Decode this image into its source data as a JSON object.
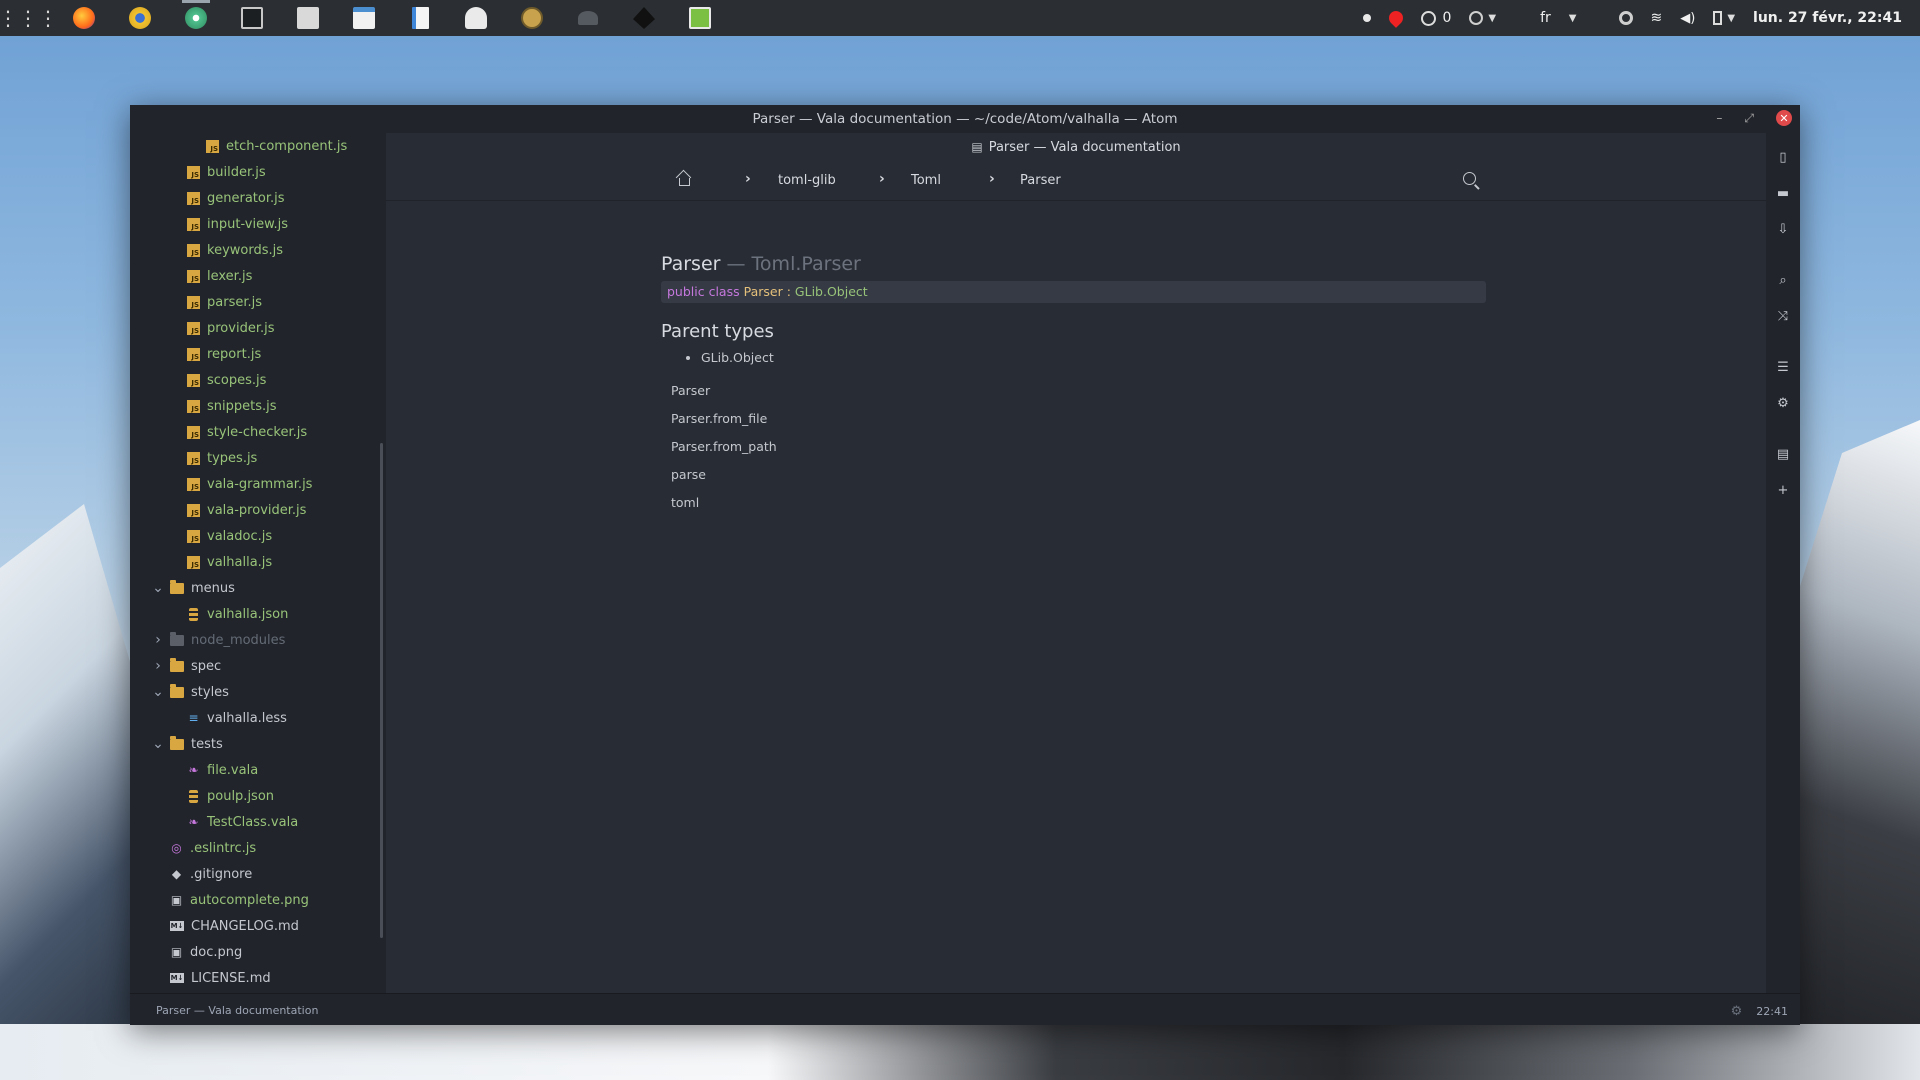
{
  "window": {
    "title": "Parser — Vala documentation — ~/code/Atom/valhalla — Atom",
    "minimize": "–",
    "maximize": "⤢",
    "close": "✕"
  },
  "topbar": {
    "apps_glyph": "⋮⋮⋮",
    "github_count": "0",
    "keyboard_layout": "fr",
    "clock": "lun. 27 févr., 22:41"
  },
  "tree": {
    "rows": [
      {
        "label": "etch-component.js",
        "type": "js",
        "color": "green"
      },
      {
        "label": "builder.js",
        "type": "js",
        "color": "green"
      },
      {
        "label": "generator.js",
        "type": "js",
        "color": "green"
      },
      {
        "label": "input-view.js",
        "type": "js",
        "color": "green"
      },
      {
        "label": "keywords.js",
        "type": "js",
        "color": "green"
      },
      {
        "label": "lexer.js",
        "type": "js",
        "color": "green"
      },
      {
        "label": "parser.js",
        "type": "js",
        "color": "green"
      },
      {
        "label": "provider.js",
        "type": "js",
        "color": "green"
      },
      {
        "label": "report.js",
        "type": "js",
        "color": "green"
      },
      {
        "label": "scopes.js",
        "type": "js",
        "color": "green"
      },
      {
        "label": "snippets.js",
        "type": "js",
        "color": "green"
      },
      {
        "label": "style-checker.js",
        "type": "js",
        "color": "green"
      },
      {
        "label": "types.js",
        "type": "js",
        "color": "green"
      },
      {
        "label": "vala-grammar.js",
        "type": "js",
        "color": "green"
      },
      {
        "label": "vala-provider.js",
        "type": "js",
        "color": "green"
      },
      {
        "label": "valadoc.js",
        "type": "js",
        "color": "green"
      },
      {
        "label": "valhalla.js",
        "type": "js",
        "color": "green"
      },
      {
        "label": "menus",
        "type": "folder-open",
        "color": "plain"
      },
      {
        "label": "valhalla.json",
        "type": "json",
        "color": "green"
      },
      {
        "label": "node_modules",
        "type": "folder-closed-dim",
        "color": "dim"
      },
      {
        "label": "spec",
        "type": "folder-closed",
        "color": "plain"
      },
      {
        "label": "styles",
        "type": "folder-open",
        "color": "plain"
      },
      {
        "label": "valhalla.less",
        "type": "less",
        "color": "plain"
      },
      {
        "label": "tests",
        "type": "folder-open",
        "color": "plain"
      },
      {
        "label": "file.vala",
        "type": "vala",
        "color": "green"
      },
      {
        "label": "poulp.json",
        "type": "json",
        "color": "green"
      },
      {
        "label": "TestClass.vala",
        "type": "vala",
        "color": "green"
      },
      {
        "label": ".eslintrc.js",
        "type": "eslint",
        "color": "green"
      },
      {
        "label": ".gitignore",
        "type": "git",
        "color": "plain"
      },
      {
        "label": "autocomplete.png",
        "type": "image",
        "color": "green"
      },
      {
        "label": "CHANGELOG.md",
        "type": "md",
        "color": "plain"
      },
      {
        "label": "doc.png",
        "type": "image",
        "color": "plain"
      },
      {
        "label": "LICENSE.md",
        "type": "md",
        "color": "plain"
      }
    ]
  },
  "doc": {
    "tab_title": "Parser — Vala documentation",
    "breadcrumbs": [
      "toml-glib",
      "Toml",
      "Parser"
    ],
    "heading": "Parser",
    "heading_sub": "— Toml.Parser",
    "signature": {
      "keyword": "public class",
      "class_name": "Parser",
      "colon": ":",
      "base": "GLib.Object"
    },
    "parent_types_title": "Parent types",
    "parent_types": [
      "GLib.Object"
    ],
    "members": [
      "Parser",
      "Parser.from_file",
      "Parser.from_path",
      "parse",
      "toml"
    ]
  },
  "status": {
    "left_text": "Parser — Vala documentation",
    "time": "22:41"
  }
}
